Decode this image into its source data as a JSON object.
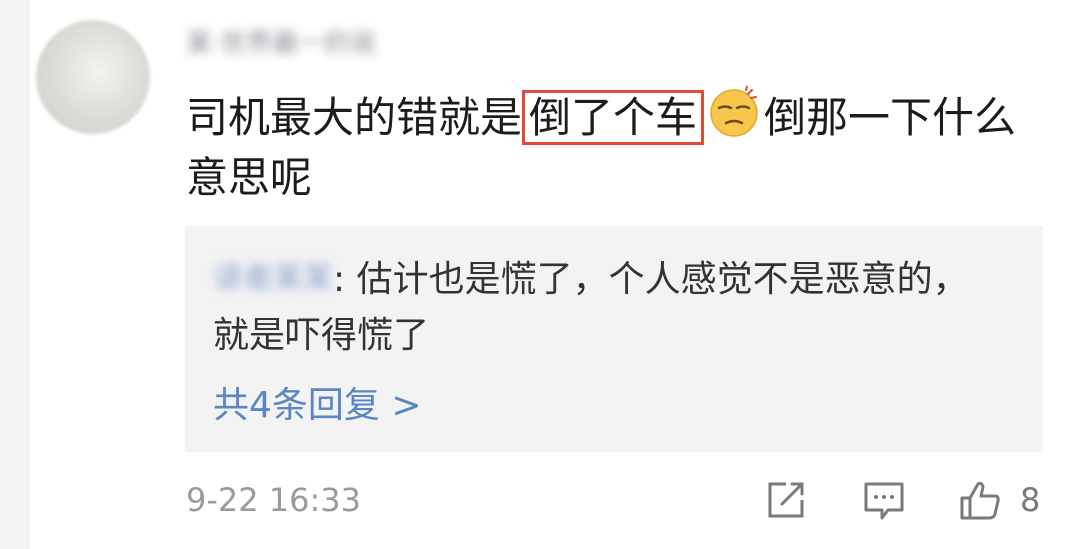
{
  "comment": {
    "username": "某·世界最一的说",
    "text_before": "司机最大的错就是",
    "highlighted": "倒了个车",
    "emoji": "sweat-smile-emoji",
    "text_after": "倒那一下什么意思呢"
  },
  "reply": {
    "username": "读者某某",
    "text": ": 估计也是慌了，个人感觉不是恶意的，就是吓得慌了",
    "count_label": "共4条回复 >"
  },
  "meta": {
    "timestamp": "9-22 16:33",
    "like_count": "8"
  },
  "colors": {
    "highlight_border": "#e04a3a",
    "link": "#5a86c4",
    "reply_bg": "#f3f3f3"
  }
}
